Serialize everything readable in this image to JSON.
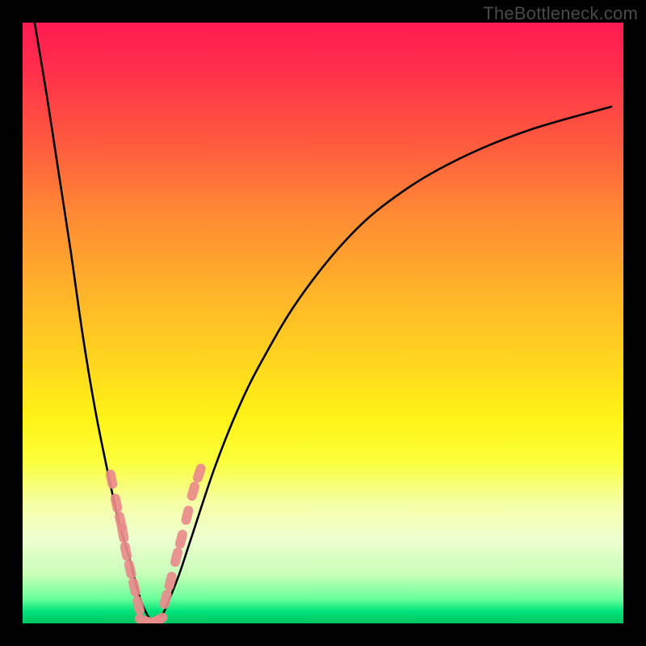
{
  "watermark": "TheBottleneck.com",
  "chart_data": {
    "type": "line",
    "title": "",
    "xlabel": "",
    "ylabel": "",
    "xlim": [
      0,
      100
    ],
    "ylim": [
      0,
      100
    ],
    "grid": false,
    "series": [
      {
        "name": "bottleneck-curve",
        "x": [
          2,
          4,
          6,
          8,
          10,
          12,
          14,
          16,
          18,
          19,
          20,
          21,
          22,
          23,
          24,
          26,
          28,
          32,
          36,
          40,
          46,
          54,
          62,
          72,
          84,
          98
        ],
        "y": [
          100,
          88,
          75,
          62,
          48,
          36,
          26,
          17,
          10,
          6,
          3,
          1,
          0,
          1,
          3,
          8,
          14,
          26,
          36,
          44,
          54,
          64,
          71,
          77,
          82,
          86
        ]
      }
    ],
    "markers": [
      {
        "name": "left-branch-markers",
        "x": [
          14.8,
          15.6,
          16.3,
          16.7,
          17.2,
          17.9,
          18.6,
          19.3
        ],
        "y": [
          24,
          20,
          17,
          15,
          12,
          9,
          6,
          3
        ]
      },
      {
        "name": "valley-markers",
        "x": [
          20.2,
          21.0,
          21.8,
          22.6
        ],
        "y": [
          0.5,
          0.2,
          0.2,
          0.6
        ]
      },
      {
        "name": "right-branch-markers",
        "x": [
          23.8,
          24.6,
          25.6,
          26.4,
          27.4,
          28.4,
          29.4
        ],
        "y": [
          4,
          7,
          11,
          14,
          18,
          22,
          25
        ]
      }
    ],
    "background_gradient": {
      "top": "#ff1b52",
      "mid": "#ffe820",
      "bottom": "#00c562"
    }
  }
}
